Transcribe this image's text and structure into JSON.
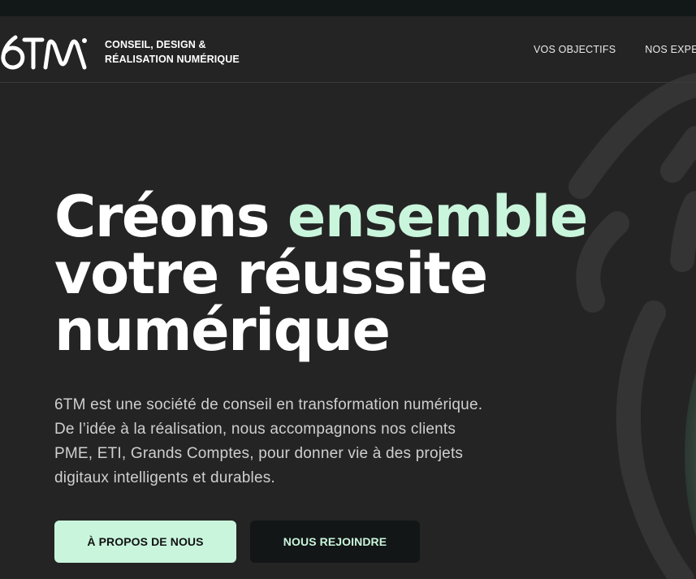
{
  "brand": {
    "logo_text": "6TM",
    "tagline_line1": "CONSEIL, DESIGN &",
    "tagline_line2": "RÉALISATION NUMÉRIQUE"
  },
  "nav": {
    "items": [
      {
        "label": "VOS OBJECTIFS"
      },
      {
        "label": "NOS EXPE"
      }
    ]
  },
  "hero": {
    "title_part1": "Créons ",
    "title_accent": "ensemble",
    "title_line2": "votre réussite",
    "title_line3": "numérique",
    "description": "6TM est une société de conseil en transformation numérique. De l’idée à la réalisation, nous accompagnons nos clients PME, ETI, Grands Comptes, pour donner vie à des projets digitaux intelligents et durables.",
    "primary_button": "À PROPOS DE NOUS",
    "secondary_button": "NOUS REJOINDRE"
  },
  "colors": {
    "background": "#242424",
    "topbar": "#121817",
    "accent": "#c9f5dc",
    "dark_button": "#131616"
  }
}
